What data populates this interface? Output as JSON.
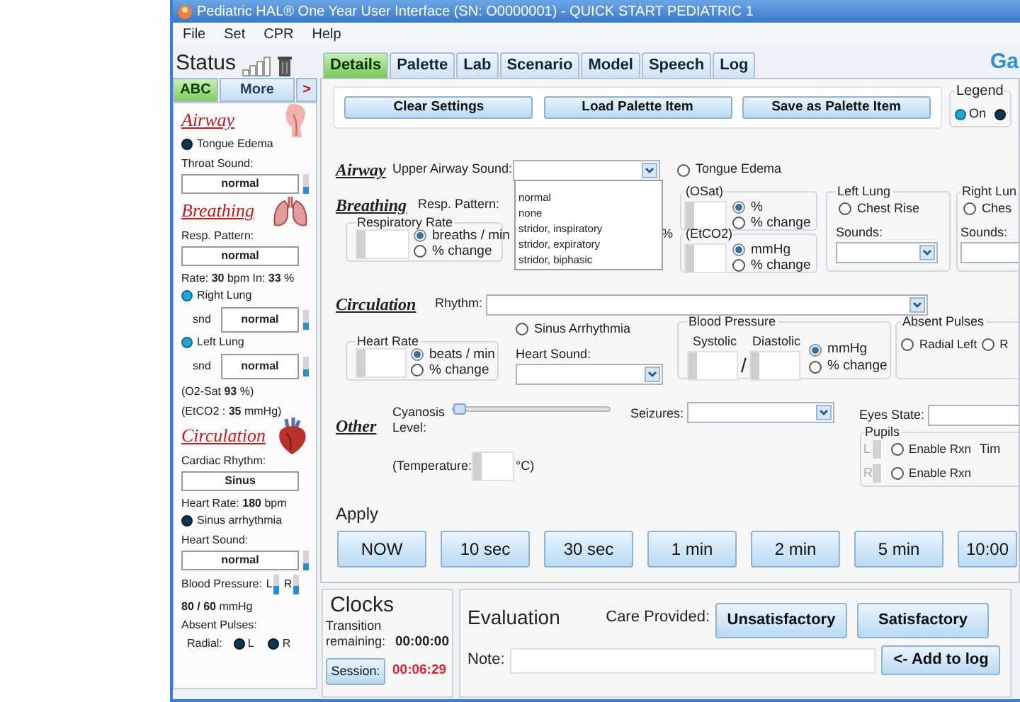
{
  "window": {
    "title": "Pediatric HAL® One Year User Interface (SN: O0000001) - QUICK START PEDIATRIC 1"
  },
  "menu": [
    "File",
    "Set",
    "CPR",
    "Help"
  ],
  "status": {
    "title": "Status",
    "tabs": [
      {
        "label": "ABC",
        "selected": true
      },
      {
        "label": "More",
        "selected": false
      },
      {
        "label": ">",
        "selected": false
      }
    ],
    "items": [
      {
        "kind": "heading",
        "text": "Airway"
      },
      {
        "kind": "dot",
        "label": "Tongue Edema",
        "on": false
      },
      {
        "kind": "label",
        "text": "Throat Sound:"
      },
      {
        "kind": "value",
        "value": "normal",
        "level": 0.35
      },
      {
        "kind": "heading",
        "text": "Breathing"
      },
      {
        "kind": "label",
        "text": "Resp. Pattern:"
      },
      {
        "kind": "value",
        "value": "normal"
      },
      {
        "kind": "rich",
        "text": "Rate: **30** bpm In: **33** %"
      },
      {
        "kind": "dot",
        "label": "Right Lung",
        "on": true
      },
      {
        "kind": "value",
        "prefix": "snd",
        "value": "normal",
        "level": 0.35
      },
      {
        "kind": "dot",
        "label": "Left Lung",
        "on": true
      },
      {
        "kind": "value",
        "prefix": "snd",
        "value": "normal",
        "level": 0.35
      },
      {
        "kind": "rich",
        "text": "(O2-Sat **93** %)"
      },
      {
        "kind": "rich",
        "text": "(EtCO2 : **35** mmHg)"
      },
      {
        "kind": "heading",
        "text": "Circulation"
      },
      {
        "kind": "label",
        "text": "Cardiac Rhythm:"
      },
      {
        "kind": "value",
        "value": "Sinus"
      },
      {
        "kind": "rich",
        "text": "Heart Rate: **180** bpm"
      },
      {
        "kind": "dot",
        "label": "Sinus arrhythmia",
        "on": false
      },
      {
        "kind": "label",
        "text": "Heart Sound:"
      },
      {
        "kind": "value",
        "value": "normal",
        "level": 0.35
      },
      {
        "kind": "bp",
        "label": "Blood Pressure:",
        "sides": [
          {
            "label": "L",
            "level": 0.4
          },
          {
            "label": "R",
            "level": 0.4
          }
        ]
      },
      {
        "kind": "rich",
        "text": "**80 / 60** mmHg"
      },
      {
        "kind": "label",
        "text": "Absent Pulses:"
      },
      {
        "kind": "pulses",
        "label": "Radial:",
        "sides": [
          {
            "label": "L",
            "on": false
          },
          {
            "label": "R",
            "on": false
          }
        ]
      }
    ]
  },
  "tabs": [
    {
      "label": "Details",
      "selected": true
    },
    {
      "label": "Palette",
      "selected": false
    },
    {
      "label": "Lab",
      "selected": false
    },
    {
      "label": "Scenario",
      "selected": false
    },
    {
      "label": "Model",
      "selected": false
    },
    {
      "label": "Speech",
      "selected": false
    },
    {
      "label": "Log",
      "selected": false
    }
  ],
  "brand": "Ga",
  "toolbar": [
    "Clear Settings",
    "Load Palette Item",
    "Save as Palette Item"
  ],
  "legend": {
    "title": "Legend",
    "items": [
      {
        "label": "On",
        "on": true
      },
      {
        "on": false
      }
    ]
  },
  "airway": {
    "heading": "Airway",
    "sound_label": "Upper Airway Sound:",
    "sound_options": [
      "normal",
      "none",
      "stridor, inspiratory",
      "stridor, expiratory",
      "stridor, biphasic"
    ],
    "tongue_edema": {
      "label": "Tongue Edema",
      "selected": false
    }
  },
  "breathing": {
    "heading": "Breathing",
    "pattern_label": "Resp. Pattern:",
    "pattern_unit": "%",
    "rate": {
      "title": "Respiratory Rate",
      "units": [
        {
          "label": "breaths / min",
          "selected": true
        },
        {
          "label": "% change",
          "selected": false
        }
      ]
    },
    "osat": {
      "title": "(OSat)",
      "units": [
        {
          "label": "%",
          "selected": true
        },
        {
          "label": "% change",
          "selected": false
        }
      ]
    },
    "etco2": {
      "title": "(EtCO2)",
      "units": [
        {
          "label": "mmHg",
          "selected": true
        },
        {
          "label": "% change",
          "selected": false
        }
      ]
    },
    "lungs": [
      {
        "title": "Left Lung",
        "chest_rise": {
          "label": "Chest Rise",
          "selected": false
        },
        "sounds_label": "Sounds:"
      },
      {
        "title": "Right Lun",
        "chest_rise": {
          "label": "Ches",
          "selected": false
        },
        "sounds_label": "Sounds:"
      }
    ]
  },
  "circulation": {
    "heading": "Circulation",
    "rhythm_label": "Rhythm:",
    "heart_rate": {
      "title": "Heart Rate",
      "units": [
        {
          "label": "beats / min",
          "selected": true
        },
        {
          "label": "% change",
          "selected": false
        }
      ]
    },
    "sinus": {
      "label": "Sinus Arrhythmia",
      "selected": false
    },
    "heart_sound_label": "Heart Sound:",
    "bp": {
      "title": "Blood Pressure",
      "systolic": "Systolic",
      "diastolic": "Diastolic",
      "slash": "/",
      "units": [
        {
          "label": "mmHg",
          "selected": true
        },
        {
          "label": "% change",
          "selected": false
        }
      ]
    },
    "absent": {
      "title": "Absent Pulses",
      "options": [
        {
          "label": "Radial Left",
          "selected": false
        },
        {
          "label": "R",
          "selected": false
        }
      ]
    }
  },
  "other": {
    "heading": "Other",
    "cyanosis_label": "Cyanosis Level:",
    "cyanosis": {
      "level": 0
    },
    "seizures_label": "Seizures:",
    "eyes_label": "Eyes State:",
    "temp_label": "(Temperature:",
    "temp_unit": "°C)",
    "pupils": {
      "title": "Pupils",
      "rows": [
        {
          "label": "L",
          "rxn": {
            "label": "Enable Rxn",
            "selected": false
          }
        },
        {
          "label": "R",
          "rxn": {
            "label": "Enable Rxn",
            "selected": false
          }
        }
      ],
      "extra": "Tim"
    }
  },
  "apply": {
    "title": "Apply",
    "buttons": [
      "NOW",
      "10 sec",
      "30 sec",
      "1 min",
      "2 min",
      "5 min",
      "10:00"
    ]
  },
  "clocks": {
    "title": "Clocks",
    "transition_label": "Transition remaining:",
    "transition": "00:00:00",
    "session_button": "Session:",
    "session": "00:06:29"
  },
  "evaluation": {
    "title": "Evaluation",
    "care_label": "Care Provided:",
    "buttons": [
      "Unsatisfactory",
      "Satisfactory"
    ],
    "note_label": "Note:",
    "add_button": "<- Add to log"
  }
}
